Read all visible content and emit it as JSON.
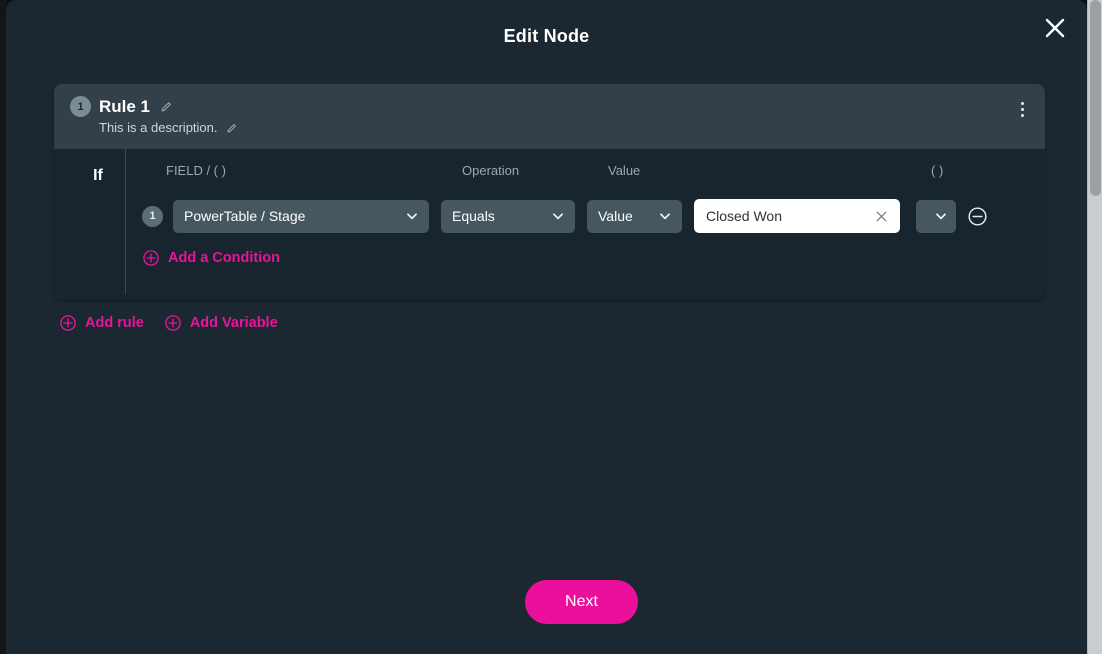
{
  "modal": {
    "title": "Edit Node",
    "close_icon": "close-icon"
  },
  "rule": {
    "number": "1",
    "title": "Rule 1",
    "description": "This is a description.",
    "title_edit_icon": "pencil-icon",
    "description_edit_icon": "pencil-icon",
    "menu_icon": "kebab-menu-icon"
  },
  "conditions_section": {
    "if_label": "If",
    "headers": {
      "field": "FIELD / ( )",
      "operation": "Operation",
      "value": "Value",
      "paren": "( )"
    },
    "rows": [
      {
        "number": "1",
        "field": "PowerTable / Stage",
        "operation": "Equals",
        "value_type": "Value",
        "value": "Closed Won",
        "paren": "",
        "clear_icon": "close-icon",
        "remove_icon": "circle-minus-icon",
        "chevron_icon": "chevron-down-icon"
      }
    ],
    "add_condition_label": "Add a Condition",
    "add_condition_icon": "circle-plus-icon"
  },
  "actions": {
    "add_rule_label": "Add rule",
    "add_rule_icon": "circle-plus-icon",
    "add_variable_label": "Add Variable",
    "add_variable_icon": "circle-plus-icon"
  },
  "footer": {
    "next_label": "Next"
  },
  "colors": {
    "accent": "#e6159b",
    "next_button": "#ec0f9c",
    "modal_background": "#1b2831",
    "rule_header": "#334049",
    "card_body": "#19252e",
    "select_background": "#47575f",
    "input_background": "#ffffff"
  }
}
